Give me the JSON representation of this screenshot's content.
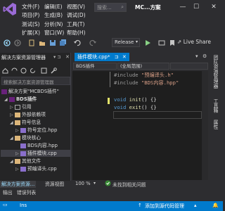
{
  "app": {
    "window_title": "MC...方案"
  },
  "menu": {
    "row1": [
      "文件(F)",
      "编辑(E)",
      "视图(V)"
    ],
    "row2": [
      "项目(P)",
      "生成(B)",
      "调试(D)"
    ],
    "row3": [
      "测试(S)",
      "分析(N)",
      "工具(T)"
    ],
    "row4": [
      "扩展(X)",
      "窗口(W)",
      "帮助(H)"
    ],
    "search_placeholder": "搜索..."
  },
  "toolbar": {
    "configuration": "Release",
    "live_share": "Live Share"
  },
  "solution_explorer": {
    "title": "解决方案资源管理器",
    "search_placeholder": "搜索解决方案资源管理器",
    "items": [
      {
        "label": "解决方案\"MCBDS插件\"",
        "indent": 0
      },
      {
        "label": "BDS插件",
        "indent": 1,
        "bold": true
      },
      {
        "label": "引用",
        "indent": 2
      },
      {
        "label": "外部依赖项",
        "indent": 2
      },
      {
        "label": "符号信息",
        "indent": 2
      },
      {
        "label": "符号定位.hpp",
        "indent": 3
      },
      {
        "label": "模块核心",
        "indent": 2
      },
      {
        "label": "BDS内容.hpp",
        "indent": 3
      },
      {
        "label": "插件模块.cpp",
        "indent": 3,
        "selected": true
      },
      {
        "label": "其他文件",
        "indent": 2
      },
      {
        "label": "预编译头.cpp",
        "indent": 3
      }
    ],
    "tabs": [
      "解决方案资源...",
      "资源视图"
    ]
  },
  "editor": {
    "tab_label": "插件模块.cpp*",
    "nav_project": "BDS插件",
    "nav_scope": "(全局范围)",
    "code": [
      {
        "pre": "#include",
        "str": " \"预编译头.h\""
      },
      {
        "pre": "#include",
        "str": " \"BDS内容.hpp\""
      },
      {
        "blank": true
      },
      {
        "kw": "void",
        "fn": " init",
        "rest": "() {}"
      },
      {
        "kw": "void",
        "fn": " exit",
        "rest": "() {}"
      }
    ],
    "zoom": "100 %",
    "issues": "未找到相关问题"
  },
  "right_tabs": [
    "团队资源管理器",
    "工具箱",
    "属性"
  ],
  "bottom_tabs": [
    "输出",
    "错误列表"
  ],
  "statusbar": {
    "left": "Ins",
    "right": "添加到源代码管理"
  },
  "colors": {
    "accent": "#007acc",
    "background": "#2d2d30",
    "editor_bg": "#1e1e1e"
  }
}
